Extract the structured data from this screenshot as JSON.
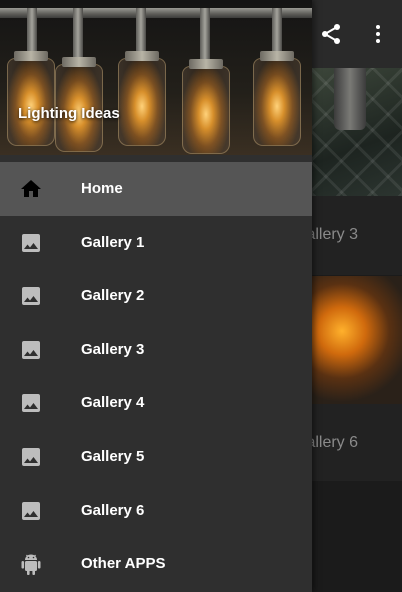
{
  "drawer": {
    "title": "Lighting Ideas",
    "items": [
      {
        "label": "Home",
        "icon": "home-icon",
        "active": true
      },
      {
        "label": "Gallery 1",
        "icon": "image-icon"
      },
      {
        "label": "Gallery 2",
        "icon": "image-icon"
      },
      {
        "label": "Gallery 3",
        "icon": "image-icon"
      },
      {
        "label": "Gallery 4",
        "icon": "image-icon"
      },
      {
        "label": "Gallery 5",
        "icon": "image-icon"
      },
      {
        "label": "Gallery 6",
        "icon": "image-icon"
      },
      {
        "label": "Other APPS",
        "icon": "android-icon"
      }
    ]
  },
  "toolbar": {
    "actions": [
      "share-icon",
      "more-vert-icon"
    ]
  },
  "background": {
    "cards": [
      {
        "caption": "Gallery 3"
      },
      {
        "caption": "Gallery 6"
      }
    ]
  },
  "colors": {
    "drawer_bg": "#2f2f2f",
    "active_item_bg": "#555555",
    "toolbar_bg": "#2a2a2a",
    "icon_light": "#ffffff",
    "icon_gray": "#bdbdbd"
  }
}
